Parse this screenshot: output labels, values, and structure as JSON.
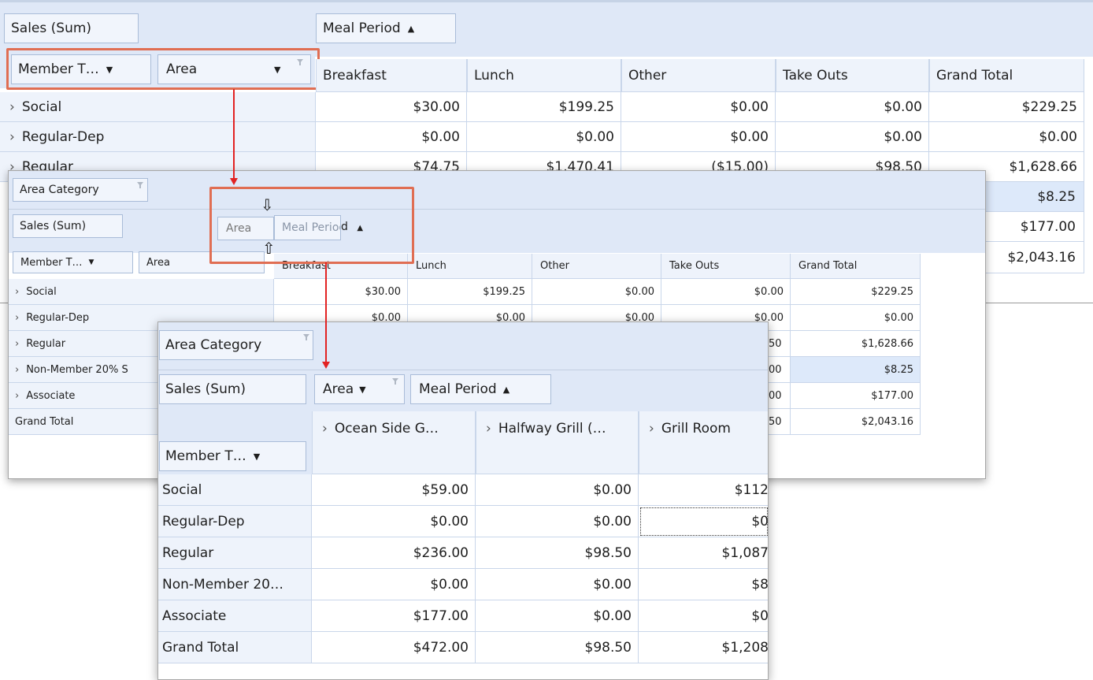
{
  "colors": {
    "header_band": "#dfe8f7",
    "grid_line": "#c9d6ea",
    "highlight_box": "#e06e53",
    "arrow": "#e22222",
    "row_highlight": "#dde9fa"
  },
  "icons": [
    "filter-funnel-icon",
    "dropdown-arrow-icon",
    "sort-ascending-icon",
    "expand-chevron-icon",
    "drag-cursor-icon"
  ],
  "step1": {
    "data_field": "Sales (Sum)",
    "column_field": "Meal Period",
    "row_fields": [
      "Member T…",
      "Area"
    ],
    "columns": [
      "Breakfast",
      "Lunch",
      "Other",
      "Take Outs",
      "Grand Total"
    ],
    "rows": [
      {
        "label": "Social",
        "values": [
          "$30.00",
          "$199.25",
          "$0.00",
          "$0.00",
          "$229.25"
        ]
      },
      {
        "label": "Regular-Dep",
        "values": [
          "$0.00",
          "$0.00",
          "$0.00",
          "$0.00",
          "$0.00"
        ]
      },
      {
        "label": "Regular",
        "values": [
          "$74.75",
          "$1,470.41",
          "($15.00)",
          "$98.50",
          "$1,628.66"
        ]
      }
    ],
    "visible_totals": [
      "$8.25",
      "$177.00",
      "$2,043.16"
    ]
  },
  "step2": {
    "filter_field": "Area Category",
    "data_field": "Sales (Sum)",
    "drag_area_label": "Area",
    "drag_meal_label": "Meal Period",
    "drag_meal_suffix": "d",
    "row_fields": [
      "Member T…",
      "Area"
    ],
    "columns": [
      "Breakfast",
      "Lunch",
      "Other",
      "Take Outs",
      "Grand Total"
    ],
    "rows": [
      {
        "label": "Social",
        "values": [
          "$30.00",
          "$199.25",
          "$0.00",
          "$0.00",
          "$229.25"
        ]
      },
      {
        "label": "Regular-Dep",
        "values": [
          "$0.00",
          "$0.00",
          "$0.00",
          "$0.00",
          "$0.00"
        ]
      },
      {
        "label": "Regular",
        "partial": "50",
        "total": "$1,628.66"
      },
      {
        "label": "Non-Member 20% S",
        "partial": "00",
        "total": "$8.25"
      },
      {
        "label": "Associate",
        "partial": "00",
        "total": "$177.00"
      },
      {
        "label": "Grand Total",
        "partial": "50",
        "total": "$2,043.16"
      }
    ]
  },
  "step3": {
    "filter_field": "Area Category",
    "data_field": "Sales (Sum)",
    "column_fields": [
      "Area",
      "Meal Period"
    ],
    "row_field": "Member T…",
    "columns": [
      "Ocean Side G…",
      "Halfway Grill (…",
      "Grill Room"
    ],
    "rows": [
      {
        "label": "Social",
        "values": [
          "$59.00",
          "$0.00",
          "$112"
        ]
      },
      {
        "label": "Regular-Dep",
        "values": [
          "$0.00",
          "$0.00",
          "$0"
        ]
      },
      {
        "label": "Regular",
        "values": [
          "$236.00",
          "$98.50",
          "$1,087"
        ]
      },
      {
        "label": "Non-Member 20…",
        "values": [
          "$0.00",
          "$0.00",
          "$8"
        ]
      },
      {
        "label": "Associate",
        "values": [
          "$177.00",
          "$0.00",
          "$0"
        ]
      },
      {
        "label": "Grand Total",
        "values": [
          "$472.00",
          "$98.50",
          "$1,208"
        ]
      }
    ]
  }
}
